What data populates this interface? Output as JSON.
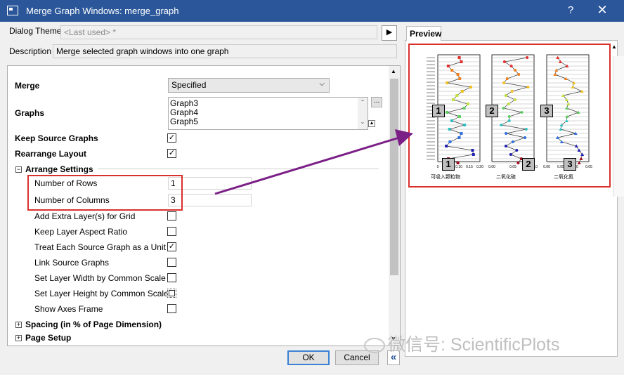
{
  "window": {
    "title": "Merge Graph Windows: merge_graph",
    "help_glyph": "?",
    "close_glyph": "✕"
  },
  "theme": {
    "label": "Dialog Theme",
    "value": "<Last used> *",
    "arrow": "▶"
  },
  "description": {
    "label": "Description",
    "value": "Merge selected graph windows into one graph"
  },
  "merge": {
    "label": "Merge",
    "value": "Specified"
  },
  "graphs": {
    "label": "Graphs",
    "items": [
      "Graph3",
      "Graph4",
      "Graph5"
    ],
    "browse": "..."
  },
  "keep_source": {
    "label": "Keep Source Graphs",
    "checked": "✓"
  },
  "rearrange": {
    "label": "Rearrange Layout",
    "checked": "✓"
  },
  "arrange": {
    "label": "Arrange Settings",
    "rows_label": "Number of Rows",
    "rows_value": "1",
    "cols_label": "Number of Columns",
    "cols_value": "3",
    "options": [
      {
        "label": "Add Extra Layer(s) for Grid",
        "check": ""
      },
      {
        "label": "Keep Layer Aspect Ratio",
        "check": ""
      },
      {
        "label": "Treat Each Source Graph as a Unit",
        "check": "✓"
      },
      {
        "label": "Link Source Graphs",
        "check": ""
      },
      {
        "label": "Set Layer Width by Common Scale",
        "check": ""
      },
      {
        "label": "Set Layer Height by Common Scale",
        "check": ""
      },
      {
        "label": "Show Axes Frame",
        "check": ""
      }
    ]
  },
  "spacing": {
    "label": "Spacing (in % of Page Dimension)"
  },
  "page_setup": {
    "label": "Page Setup"
  },
  "buttons": {
    "ok": "OK",
    "cancel": "Cancel",
    "collapse": "«"
  },
  "preview": {
    "tab": "Preview",
    "top_numbers": [
      "1",
      "2",
      "3"
    ],
    "bottom_numbers": [
      "1",
      "2",
      "3"
    ],
    "x_ticks": [
      [
        "0",
        "0.05",
        "0.10",
        "0.15",
        "0.20"
      ],
      [
        "0.00",
        "0.05",
        "0.10"
      ],
      [
        "0.00",
        "0.05",
        "0.10",
        "0.05"
      ]
    ],
    "x_labels": [
      "可吸入颗粒物",
      "二氧化硫",
      "二氧化氮"
    ]
  },
  "watermark": "微信号: ScientificPlots",
  "colors": {
    "titlebar": "#2b579a",
    "highlight": "#d9302c",
    "arrow": "#7b1f87"
  }
}
